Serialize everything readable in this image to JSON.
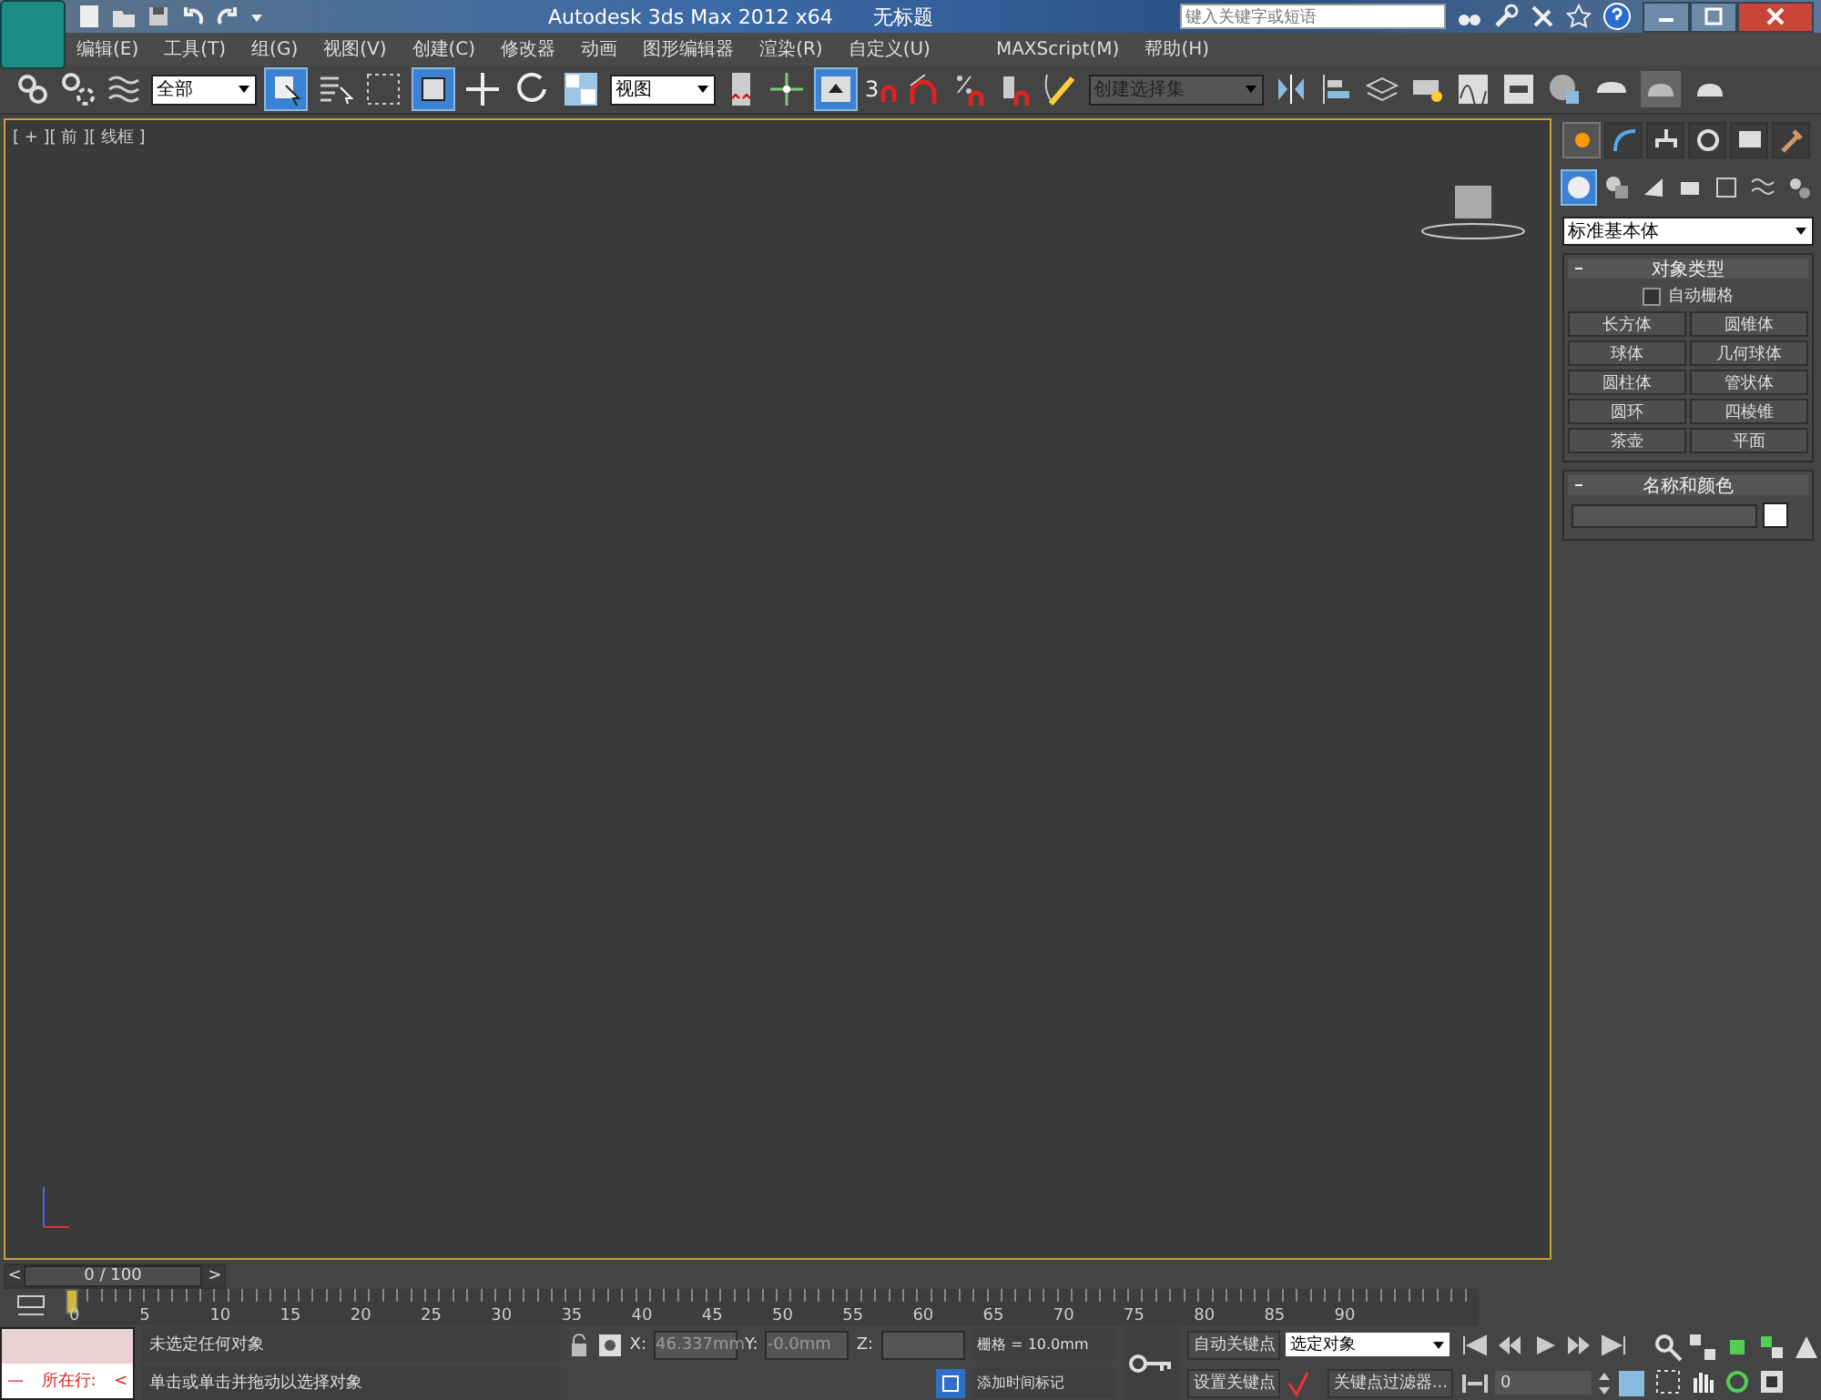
{
  "title_bar": {
    "app_title": "Autodesk 3ds Max  2012 x64",
    "file_title": "无标题",
    "search_placeholder": "键入关键字或短语"
  },
  "menu": [
    "编辑(E)",
    "工具(T)",
    "组(G)",
    "视图(V)",
    "创建(C)",
    "修改器",
    "动画",
    "图形编辑器",
    "渲染(R)",
    "自定义(U)",
    "MAXScript(M)",
    "帮助(H)"
  ],
  "toolbar": {
    "selection_filter": "全部",
    "reference_coord": "视图",
    "snap_label": "3",
    "named_selection": "创建选择集"
  },
  "viewport": {
    "label": "[ + ][ 前 ][ 线框 ]"
  },
  "command_panel": {
    "tabs": [
      {
        "selected": true
      },
      {
        "selected": false
      },
      {
        "selected": false
      },
      {
        "selected": false
      },
      {
        "selected": false
      },
      {
        "selected": false
      }
    ],
    "category": "标准基本体",
    "object_type": {
      "title": "对象类型",
      "autogrid": {
        "label": "自动栅格",
        "checked": false
      },
      "buttons": [
        "长方体",
        "圆锥体",
        "球体",
        "几何球体",
        "圆柱体",
        "管状体",
        "圆环",
        "四棱锥",
        "茶壶",
        "平面"
      ]
    },
    "name_color": {
      "title": "名称和颜色",
      "color": "#ffffff"
    }
  },
  "time_slider": {
    "prev": "<",
    "position": "0 / 100",
    "next": ">"
  },
  "track_bar": {
    "ticks": [
      "0",
      "5",
      "10",
      "15",
      "20",
      "25",
      "30",
      "35",
      "40",
      "45",
      "50",
      "55",
      "60",
      "65",
      "70",
      "75",
      "80",
      "85",
      "90"
    ]
  },
  "status": {
    "maxscript_label": "所在行:",
    "maxscript_dash": "—",
    "maxscript_arrow": "<",
    "prompt": "未选定任何对象",
    "hint": "单击或单击并拖动以选择对象",
    "x_label": "X:",
    "x_value": "46.337mm",
    "y_label": "Y:",
    "y_value": "-0.0mm",
    "z_label": "Z:",
    "grid": "栅格 = 10.0mm",
    "add_time_tag": "添加时间标记",
    "auto_key": "自动关键点",
    "set_key": "设置关键点",
    "key_mode": "选定对象",
    "key_filters": "关键点过滤器...",
    "frame": "0"
  }
}
